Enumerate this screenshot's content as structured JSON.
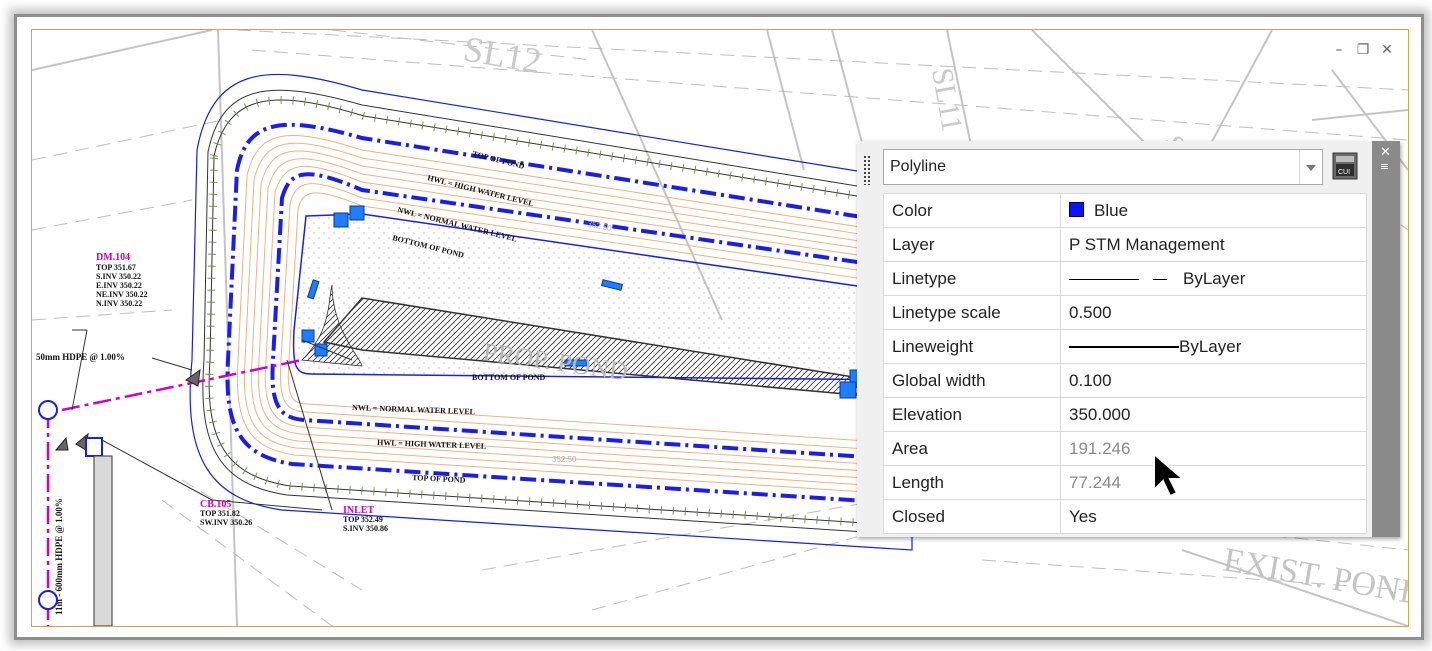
{
  "drawing": {
    "labels": {
      "parcel_sl12": "SL12",
      "parcel_sl11": "SL11",
      "parcel_s": "S",
      "prop_pond": "PROP. POND",
      "exist_pond": "EXIST. POND",
      "top_of_pond_a": "TOP OF POND",
      "hwl_a": "HWL = HIGH WATER LEVEL",
      "nwl_a": "NWL = NORMAL WATER LEVEL",
      "bottom_of_pond_a": "BOTTOM OF POND",
      "bottom_of_pond_b": "BOTTOM OF POND",
      "nwl_b": "NWL = NORMAL WATER LEVEL",
      "hwl_b": "HWL = HIGH WATER LEVEL",
      "top_of_pond_b": "TOP OF POND",
      "contour_a": "352.50",
      "contour_b": "352.50",
      "dm_name": "DM.104",
      "dm_top": "TOP 351.67",
      "dm_sinv": "S.INV 350.22",
      "dm_einv": "E.INV 350.22",
      "dm_neinv": "NE.INV 350.22",
      "dm_ninv": "N.INV 350.22",
      "pipe_label": "50mm HDPE @ 1.00%",
      "vert_pipe": "11m - 600mm HDPE @ 1.00%",
      "cb_name": "CB.105",
      "cb_top": "TOP 351.82",
      "cb_inv": "SW.INV 350.26",
      "inlet_name": "INLET",
      "inlet_top": "TOP 352.49",
      "inlet_inv": "S.INV 350.86"
    }
  },
  "window_controls": {
    "minimize": "–",
    "restore": "❐",
    "close": "✕"
  },
  "properties": {
    "selected_type": "Polyline",
    "rows": [
      {
        "key": "Color",
        "value": "Blue"
      },
      {
        "key": "Layer",
        "value": "P STM Management"
      },
      {
        "key": "Linetype",
        "value": "ByLayer"
      },
      {
        "key": "Linetype scale",
        "value": "0.500"
      },
      {
        "key": "Lineweight",
        "value": "ByLayer"
      },
      {
        "key": "Global width",
        "value": "0.100"
      },
      {
        "key": "Elevation",
        "value": "350.000"
      },
      {
        "key": "Area",
        "value": "191.246"
      },
      {
        "key": "Length",
        "value": "77.244"
      },
      {
        "key": "Closed",
        "value": "Yes"
      }
    ],
    "cui_label": "CUI",
    "colors": {
      "blue": "#0a14ff",
      "magenta": "#cc00cc",
      "pond_blue": "#1a1ee6",
      "contour": "#f0b183"
    }
  }
}
